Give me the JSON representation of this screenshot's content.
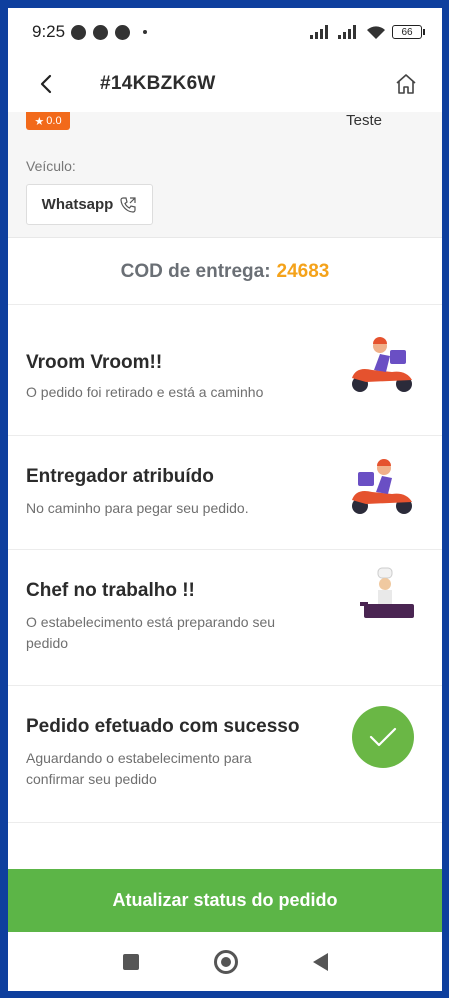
{
  "status_bar": {
    "time": "9:25",
    "battery": "66",
    "icons": [
      "ad-icon",
      "chrome-icon",
      "chrome-icon",
      "signal-icon",
      "signal-icon",
      "wifi-icon",
      "battery-icon"
    ]
  },
  "header": {
    "order_id": "#14KBZK6W",
    "back_icon": "chevron-left-icon",
    "home_icon": "home-icon"
  },
  "driver": {
    "rating": "0.0",
    "name": "Teste",
    "vehicle_label": "Veículo:",
    "whatsapp_label": "Whatsapp"
  },
  "cod": {
    "label": "COD de entrega:",
    "code": "24683"
  },
  "timeline": [
    {
      "title": "Vroom Vroom!!",
      "subtitle": "O pedido foi retirado e está a caminho",
      "icon": "scooter-rider-icon"
    },
    {
      "title": "Entregador atribuído",
      "subtitle": "No caminho para pegar seu pedido.",
      "icon": "scooter-rider-icon"
    },
    {
      "title": "Chef no trabalho !!",
      "subtitle": "O estabelecimento está preparando seu pedido",
      "icon": "chef-icon"
    },
    {
      "title": "Pedido efetuado com sucesso",
      "subtitle": "Aguardando o estabelecimento para confirmar seu pedido",
      "icon": "check-icon"
    }
  ],
  "colors": {
    "accent_green": "#5cb547",
    "code_orange": "#f4a21a",
    "rating_orange": "#f26a1b",
    "frame_blue": "#0e3f9e"
  },
  "actions": {
    "update_status": "Atualizar status do pedido"
  }
}
